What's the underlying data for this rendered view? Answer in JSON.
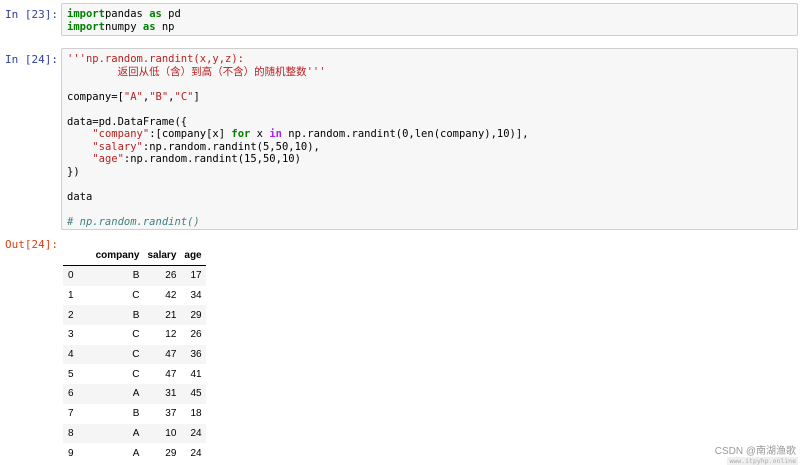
{
  "cells": [
    {
      "prompt": "In  [23]:",
      "code_lines": [
        [
          [
            "kw",
            "import"
          ],
          [
            "",
            "pandas "
          ],
          [
            "kw",
            "as"
          ],
          [
            "",
            " pd"
          ]
        ],
        [
          [
            "kw",
            "import"
          ],
          [
            "",
            "numpy "
          ],
          [
            "kw",
            "as"
          ],
          [
            "",
            " np"
          ]
        ]
      ]
    },
    {
      "prompt": "In  [24]:",
      "code_lines": [
        [
          [
            "str",
            "'''np.random.randint(x,y,z):"
          ]
        ],
        [
          [
            "str",
            "        返回从低（含）到高（不含）的随机整数'''"
          ]
        ],
        [
          [
            "",
            ""
          ]
        ],
        [
          [
            "",
            "company=["
          ],
          [
            "str",
            "\"A\""
          ],
          [
            "",
            ","
          ],
          [
            "str",
            "\"B\""
          ],
          [
            "",
            ","
          ],
          [
            "str",
            "\"C\""
          ],
          [
            "",
            "]"
          ]
        ],
        [
          [
            "",
            ""
          ]
        ],
        [
          [
            "",
            "data=pd.DataFrame({"
          ]
        ],
        [
          [
            "",
            "    "
          ],
          [
            "str",
            "\"company\""
          ],
          [
            "",
            ":[company[x] "
          ],
          [
            "kw",
            "for"
          ],
          [
            "",
            " x "
          ],
          [
            "op",
            "in"
          ],
          [
            "",
            " np.random.randint(0,len(company),10)],"
          ]
        ],
        [
          [
            "",
            "    "
          ],
          [
            "str",
            "\"salary\""
          ],
          [
            "",
            ":np.random.randint(5,50,10),"
          ]
        ],
        [
          [
            "",
            "    "
          ],
          [
            "str",
            "\"age\""
          ],
          [
            "",
            ":np.random.randint(15,50,10)"
          ]
        ],
        [
          [
            "",
            "})"
          ]
        ],
        [
          [
            "",
            ""
          ]
        ],
        [
          [
            "",
            "data"
          ]
        ],
        [
          [
            "",
            ""
          ]
        ],
        [
          [
            "com",
            "# np.random.randint()"
          ]
        ]
      ]
    }
  ],
  "output": {
    "prompt": "Out[24]:",
    "columns": [
      "",
      "company",
      "salary",
      "age"
    ],
    "rows": [
      [
        "0",
        "B",
        "26",
        "17"
      ],
      [
        "1",
        "C",
        "42",
        "34"
      ],
      [
        "2",
        "B",
        "21",
        "29"
      ],
      [
        "3",
        "C",
        "12",
        "26"
      ],
      [
        "4",
        "C",
        "47",
        "36"
      ],
      [
        "5",
        "C",
        "47",
        "41"
      ],
      [
        "6",
        "A",
        "31",
        "45"
      ],
      [
        "7",
        "B",
        "37",
        "18"
      ],
      [
        "8",
        "A",
        "10",
        "24"
      ],
      [
        "9",
        "A",
        "29",
        "24"
      ]
    ]
  },
  "watermark": {
    "text": "CSDN @南湖渔歌",
    "site": "www.itpyhp.online"
  }
}
